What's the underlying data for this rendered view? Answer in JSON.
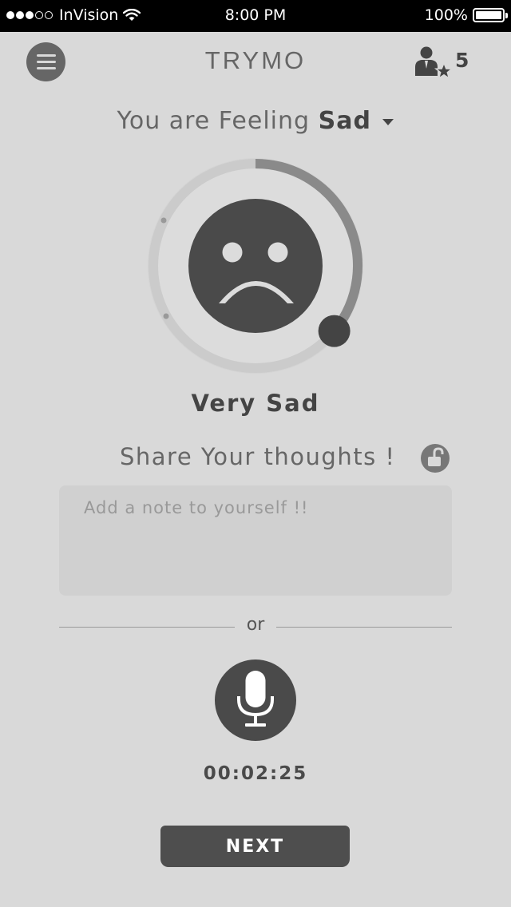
{
  "status_bar": {
    "carrier": "InVision",
    "time": "8:00 PM",
    "battery": "100%",
    "signal_bars_filled": 3,
    "signal_bars_total": 5
  },
  "header": {
    "title": "TRYMO",
    "menu_icon": "hamburger-icon",
    "friends_icon": "user-star-icon",
    "friends_count": "5"
  },
  "feeling": {
    "prefix": "You are Feeling",
    "value": "Sad"
  },
  "mood_dial": {
    "face_icon": "sad-face-icon",
    "progress": 0.36,
    "label": "Very Sad"
  },
  "share": {
    "title": "Share Your thoughts !",
    "lock_icon": "unlock-icon",
    "note_placeholder": "Add a note to yourself !!",
    "note_value": ""
  },
  "divider_text": "or",
  "recorder": {
    "mic_icon": "microphone-icon",
    "timer": "00:02:25"
  },
  "next_button": "NEXT",
  "colors": {
    "background": "#d9d9d9",
    "dark": "#4a4a4a",
    "accent_track": "#8a8a8a"
  }
}
